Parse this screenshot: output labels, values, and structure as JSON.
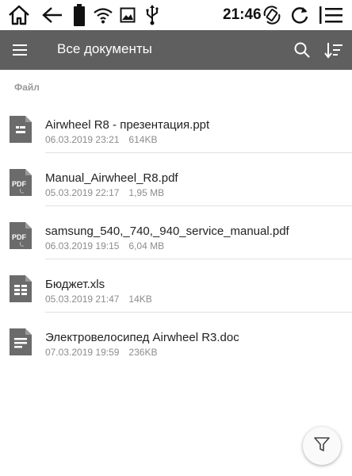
{
  "status_bar": {
    "time": "21:46",
    "icons": [
      "home-icon",
      "back-icon",
      "battery-icon",
      "wifi-icon",
      "image-icon",
      "usb-icon",
      "auto-rotate-icon",
      "refresh-icon",
      "menu-icon"
    ]
  },
  "app_bar": {
    "title": "Все документы",
    "icons": [
      "hamburger-menu-icon",
      "search-icon",
      "sort-icon"
    ]
  },
  "section_header": "Файл",
  "files": [
    {
      "name": "Airwheel R8 - презентация.ppt",
      "date": "06.03.2019 23:21",
      "size": "614KB",
      "icon": "ppt-file-icon"
    },
    {
      "name": "Manual_Airwheel_R8.pdf",
      "date": "05.03.2019 22:17",
      "size": "1,95 MB",
      "icon": "pdf-file-icon",
      "icon_label": "PDF"
    },
    {
      "name": "samsung_540,_740,_940_service_manual.pdf",
      "date": "06.03.2019 19:15",
      "size": "6,04 MB",
      "icon": "pdf-file-icon",
      "icon_label": "PDF"
    },
    {
      "name": "Бюджет.xls",
      "date": "05.03.2019 21:47",
      "size": "14KB",
      "icon": "xls-file-icon"
    },
    {
      "name": "Электровелосипед Airwheel R3.doc",
      "date": "07.03.2019 19:59",
      "size": "236KB",
      "icon": "doc-file-icon"
    }
  ],
  "fab": {
    "icon": "filter-icon"
  },
  "colors": {
    "app_bar": "#5f5f5f",
    "file_icon": "#6b6b6b",
    "meta_text": "#8c8c8c",
    "divider": "#e2e2e2"
  }
}
